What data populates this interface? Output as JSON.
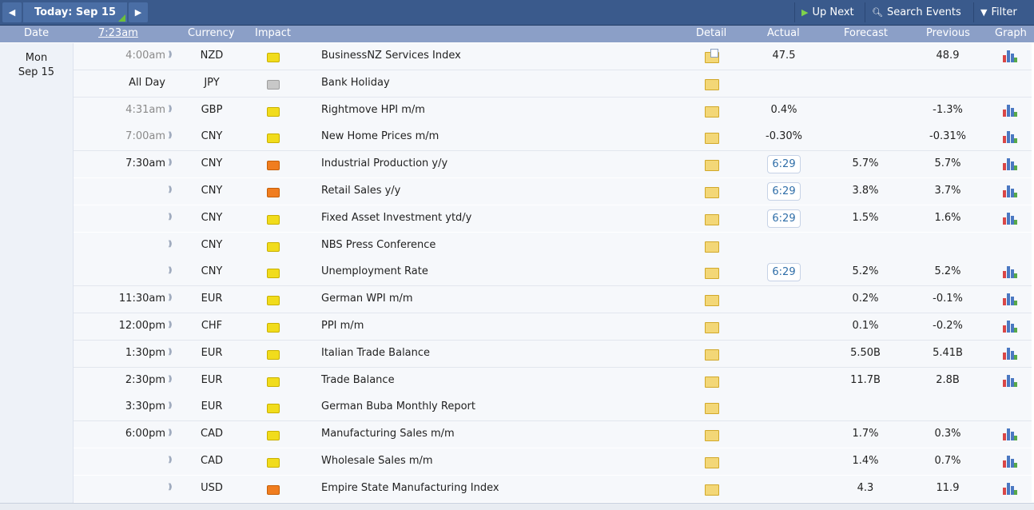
{
  "toolbar": {
    "today_label": "Today: Sep 15",
    "up_next_label": "Up Next",
    "search_label": "Search Events",
    "filter_label": "Filter",
    "prev_icon": "◀",
    "next_icon": "▶"
  },
  "columns": {
    "date": "Date",
    "time": "7:23am",
    "currency": "Currency",
    "impact": "Impact",
    "detail": "Detail",
    "actual": "Actual",
    "forecast": "Forecast",
    "previous": "Previous",
    "graph": "Graph"
  },
  "day": {
    "weekday": "Mon",
    "date": "Sep 15"
  },
  "events": [
    {
      "time": "4:00am",
      "past": true,
      "currency": "NZD",
      "impact": "low",
      "event": "BusinessNZ Services Index",
      "detail_doc": true,
      "actual": "47.5",
      "forecast": "",
      "previous": "48.9",
      "graph": true
    },
    {
      "time": "All Day",
      "past": false,
      "currency": "JPY",
      "impact": "holiday",
      "event": "Bank Holiday",
      "actual": "",
      "forecast": "",
      "previous": "",
      "graph": false,
      "nosound": true
    },
    {
      "time": "4:31am",
      "past": true,
      "currency": "GBP",
      "impact": "low",
      "event": "Rightmove HPI m/m",
      "actual": "0.4%",
      "forecast": "",
      "previous": "-1.3%",
      "graph": true
    },
    {
      "time": "7:00am",
      "past": true,
      "currency": "CNY",
      "impact": "low",
      "event": "New Home Prices m/m",
      "actual": "-0.30%",
      "forecast": "",
      "previous": "-0.31%",
      "graph": true
    },
    {
      "time": "7:30am",
      "past": false,
      "currency": "CNY",
      "impact": "medium",
      "event": "Industrial Production y/y",
      "countdown": "6:29",
      "forecast": "5.7%",
      "previous": "5.7%",
      "graph": true,
      "group": true
    },
    {
      "time": "",
      "past": false,
      "currency": "CNY",
      "impact": "medium",
      "event": "Retail Sales y/y",
      "countdown": "6:29",
      "forecast": "3.8%",
      "previous": "3.7%",
      "graph": true,
      "group": true
    },
    {
      "time": "",
      "past": false,
      "currency": "CNY",
      "impact": "low",
      "event": "Fixed Asset Investment ytd/y",
      "countdown": "6:29",
      "forecast": "1.5%",
      "previous": "1.6%",
      "graph": true,
      "group": true
    },
    {
      "time": "",
      "past": false,
      "currency": "CNY",
      "impact": "low",
      "event": "NBS Press Conference",
      "forecast": "",
      "previous": "",
      "graph": false,
      "group": true
    },
    {
      "time": "",
      "past": false,
      "currency": "CNY",
      "impact": "low",
      "event": "Unemployment Rate",
      "countdown": "6:29",
      "forecast": "5.2%",
      "previous": "5.2%",
      "graph": true
    },
    {
      "time": "11:30am",
      "past": false,
      "currency": "EUR",
      "impact": "low",
      "event": "German WPI m/m",
      "forecast": "0.2%",
      "previous": "-0.1%",
      "graph": true
    },
    {
      "time": "12:00pm",
      "past": false,
      "currency": "CHF",
      "impact": "low",
      "event": "PPI m/m",
      "forecast": "0.1%",
      "previous": "-0.2%",
      "graph": true
    },
    {
      "time": "1:30pm",
      "past": false,
      "currency": "EUR",
      "impact": "low",
      "event": "Italian Trade Balance",
      "forecast": "5.50B",
      "previous": "5.41B",
      "graph": true
    },
    {
      "time": "2:30pm",
      "past": false,
      "currency": "EUR",
      "impact": "low",
      "event": "Trade Balance",
      "forecast": "11.7B",
      "previous": "2.8B",
      "graph": true
    },
    {
      "time": "3:30pm",
      "past": false,
      "currency": "EUR",
      "impact": "low",
      "event": "German Buba Monthly Report",
      "forecast": "",
      "previous": "",
      "graph": false
    },
    {
      "time": "6:00pm",
      "past": false,
      "currency": "CAD",
      "impact": "low",
      "event": "Manufacturing Sales m/m",
      "forecast": "1.7%",
      "previous": "0.3%",
      "graph": true,
      "group": true
    },
    {
      "time": "",
      "past": false,
      "currency": "CAD",
      "impact": "low",
      "event": "Wholesale Sales m/m",
      "forecast": "1.4%",
      "previous": "0.7%",
      "graph": true,
      "group": true
    },
    {
      "time": "",
      "past": false,
      "currency": "USD",
      "impact": "medium",
      "event": "Empire State Manufacturing Index",
      "forecast": "4.3",
      "previous": "11.9",
      "graph": true,
      "last": true
    }
  ]
}
